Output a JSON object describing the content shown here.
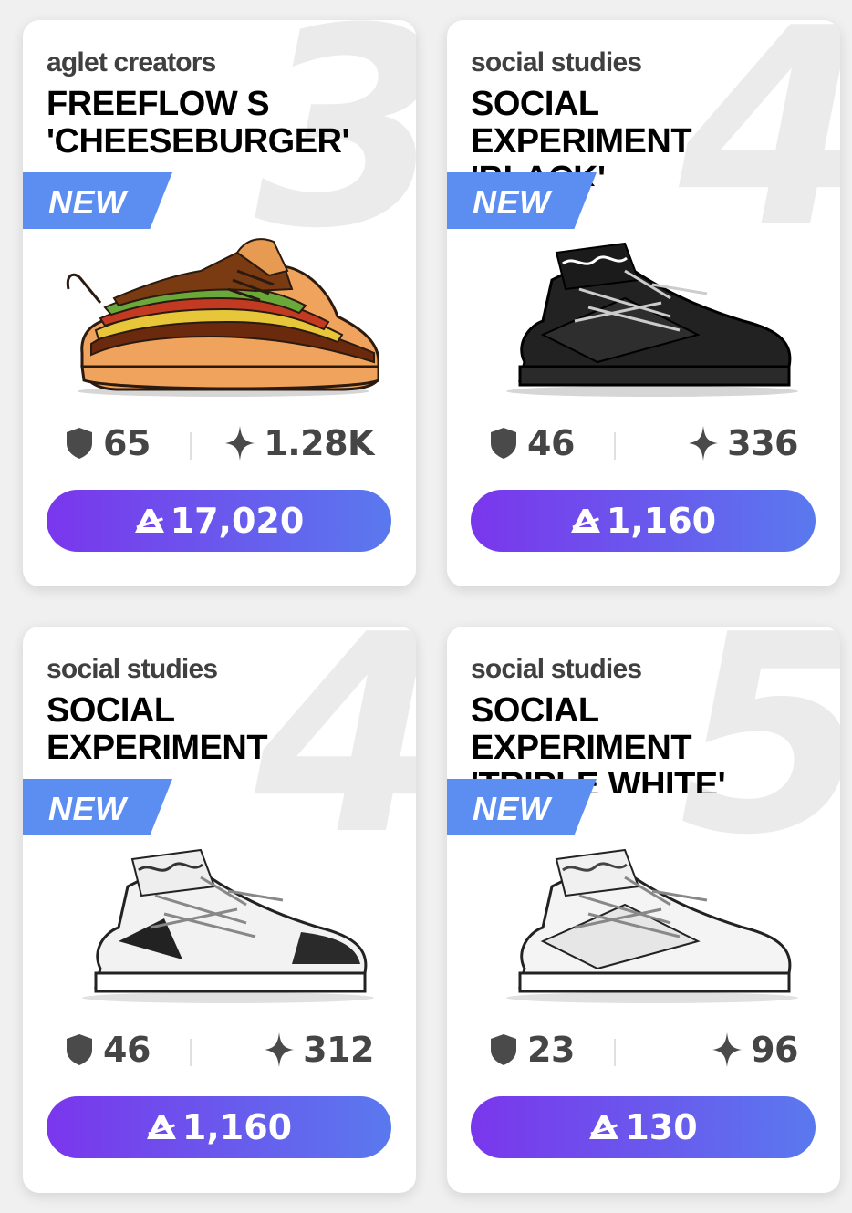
{
  "products": [
    {
      "rank": "3",
      "brand": "aglet creators",
      "title": "FREEFLOW S\n'CHEESEBURGER'",
      "badge": "NEW",
      "colorway": "cheeseburger",
      "stat_shield": "65",
      "stat_spark": "1.28K",
      "price": "17,020"
    },
    {
      "rank": "4",
      "brand": "social studies",
      "title": "SOCIAL\nEXPERIMENT\n'BLACK'",
      "badge": "NEW",
      "colorway": "black",
      "stat_shield": "46",
      "stat_spark": "336",
      "price": "1,160"
    },
    {
      "rank": "4",
      "brand": "social studies",
      "title": "SOCIAL\nEXPERIMENT",
      "badge": "NEW",
      "colorway": "white-black",
      "stat_shield": "46",
      "stat_spark": "312",
      "price": "1,160"
    },
    {
      "rank": "5",
      "brand": "social studies",
      "title": "SOCIAL\nEXPERIMENT\n'TRIPLE WHITE'",
      "badge": "NEW",
      "colorway": "triple-white",
      "stat_shield": "23",
      "stat_spark": "96",
      "price": "130"
    }
  ],
  "icons": {
    "stat_shield": "shield-icon",
    "stat_spark": "sparkle-icon",
    "price": "aglet-currency-icon"
  },
  "colors": {
    "badge": "#5b8ef0",
    "button_start": "#7a36ec",
    "button_end": "#5a79ee",
    "stat_text": "#454545"
  }
}
